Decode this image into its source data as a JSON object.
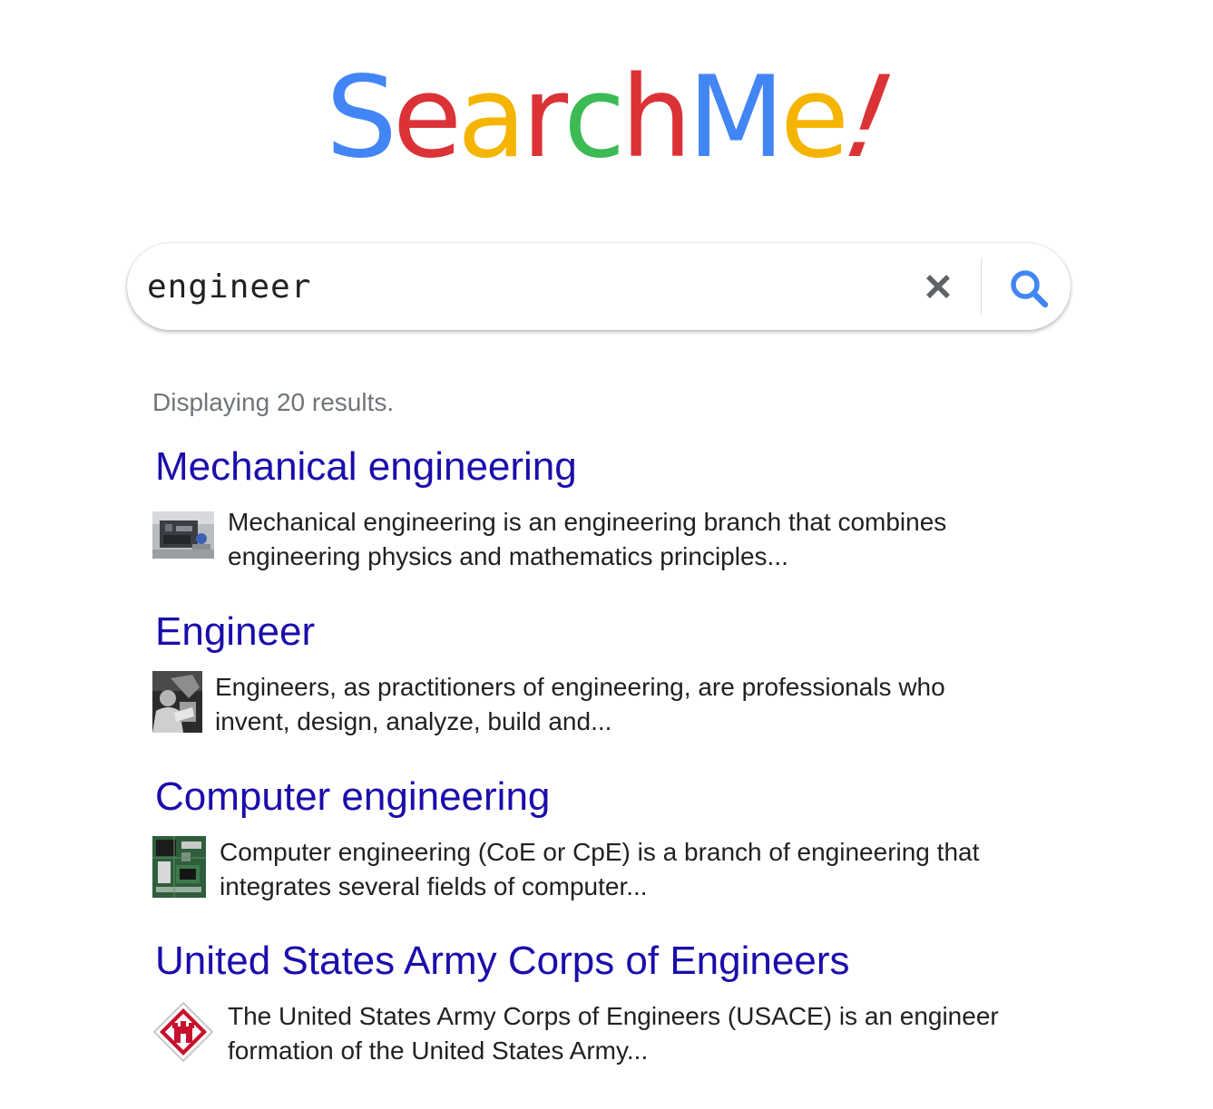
{
  "logo": {
    "letters": [
      "S",
      "e",
      "a",
      "r",
      "c",
      "h",
      "M",
      "e",
      "!"
    ],
    "colors": [
      "#4285F4",
      "#DB3236",
      "#F4B400",
      "#DB3236",
      "#3CBA54",
      "#DB3236",
      "#4285F4",
      "#F4B400",
      "#DB3236"
    ]
  },
  "search": {
    "query": "engineer",
    "placeholder": "",
    "clear_icon": "close-icon",
    "submit_icon": "search-icon",
    "icon_colors": {
      "clear": "#5f6368",
      "search": "#4285F4"
    }
  },
  "results_summary": "Displaying 20 results.",
  "results": [
    {
      "title": "Mechanical engineering",
      "snippet_line1": "Mechanical engineering is an engineering branch that combines",
      "snippet_line2": "engineering physics and mathematics principles...",
      "thumbnail": "engine-photo"
    },
    {
      "title": "Engineer",
      "snippet_line1": "Engineers, as practitioners of engineering, are professionals who",
      "snippet_line2": "invent, design, analyze, build and...",
      "thumbnail": "engineer-photo"
    },
    {
      "title": "Computer engineering",
      "snippet_line1": "Computer engineering (CoE or CpE) is a branch of engineering that",
      "snippet_line2": "integrates several fields of computer...",
      "thumbnail": "circuit-board-photo"
    },
    {
      "title": "United States Army Corps of Engineers",
      "snippet_line1": "The United States Army Corps of Engineers (USACE) is an engineer",
      "snippet_line2": "formation of the United States Army...",
      "thumbnail": "usace-castle-emblem"
    }
  ],
  "colors": {
    "link": "#1a0dab",
    "text": "#202124",
    "muted": "#70757a"
  }
}
